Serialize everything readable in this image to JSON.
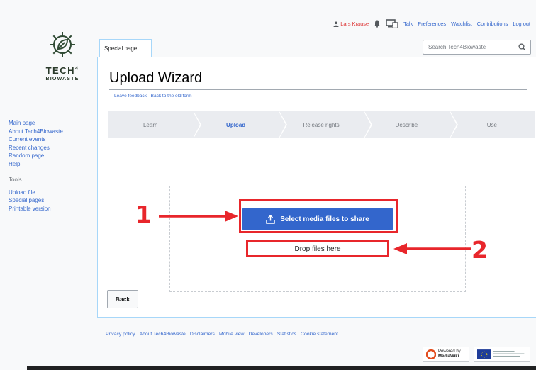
{
  "site": {
    "logo_line1": "TECH",
    "logo_sup": "4",
    "logo_line2": "BIOWASTE"
  },
  "personal": {
    "username": "Lars Krause",
    "links": [
      "Talk",
      "Preferences",
      "Watchlist",
      "Contributions",
      "Log out"
    ]
  },
  "sidebar": {
    "nav": [
      "Main page",
      "About Tech4Biowaste",
      "Current events",
      "Recent changes",
      "Random page",
      "Help"
    ],
    "tools_heading": "Tools",
    "tools": [
      "Upload file",
      "Special pages",
      "Printable version"
    ]
  },
  "tab": {
    "label": "Special page"
  },
  "search": {
    "placeholder": "Search Tech4Biowaste"
  },
  "page": {
    "title": "Upload Wizard",
    "subtitle": "Leave feedback · Back to the old form"
  },
  "steps": [
    "Learn",
    "Upload",
    "Release rights",
    "Describe",
    "Use"
  ],
  "active_step": "Upload",
  "upload": {
    "select_label": "Select media files to share",
    "drop_label": "Drop files here"
  },
  "back_label": "Back",
  "annotations": {
    "one": "1",
    "two": "2",
    "color": "#e8262b"
  },
  "footer": {
    "links": [
      "Privacy policy",
      "About Tech4Biowaste",
      "Disclaimers",
      "Mobile view",
      "Developers",
      "Statistics",
      "Cookie statement"
    ],
    "badge_mediawiki_top": "Powered by",
    "badge_mediawiki_bottom": "MediaWiki"
  },
  "colors": {
    "accent": "#3366cc",
    "highlight": "#e8262b",
    "user": "#dd3333"
  }
}
